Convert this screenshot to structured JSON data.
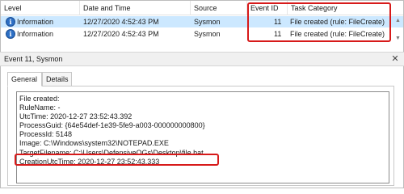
{
  "columns": [
    "Level",
    "Date and Time",
    "Source",
    "Event ID",
    "Task Category"
  ],
  "events": [
    {
      "level": "Information",
      "datetime": "12/27/2020 4:52:43 PM",
      "source": "Sysmon",
      "event_id": "11",
      "task_category": "File created (rule: FileCreate)",
      "selected": true
    },
    {
      "level": "Information",
      "datetime": "12/27/2020 4:52:43 PM",
      "source": "Sysmon",
      "event_id": "11",
      "task_category": "File created (rule: FileCreate)",
      "selected": false
    }
  ],
  "detail": {
    "title": "Event 11, Sysmon",
    "tabs": [
      "General",
      "Details"
    ],
    "active_tab": "General",
    "lines": [
      "File created:",
      "RuleName: -",
      "UtcTime: 2020-12-27 23:52:43.392",
      "ProcessGuid: {64e54def-1e39-5fe9-a003-000000000800}",
      "ProcessId: 5148",
      "Image: C:\\Windows\\system32\\NOTEPAD.EXE",
      "TargetFilename: C:\\Users\\DefensiveOGs\\Desktop\\file.bat",
      "CreationUtcTime: 2020-12-27 23:52:43.333"
    ]
  },
  "colors": {
    "highlight": "#d71a1a",
    "selection": "#cce8ff"
  },
  "icons": {
    "level": "info-icon",
    "close": "close-icon"
  }
}
